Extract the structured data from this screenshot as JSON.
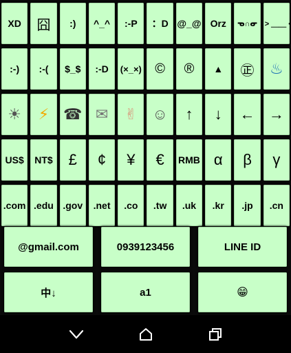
{
  "rows": [
    [
      "XD",
      "囧",
      ":)",
      "^_^",
      ":-P",
      "：D",
      "@_@",
      "Orz",
      "ᓀ∩ᓂ",
      "> ＿＿ <"
    ],
    [
      ":-)",
      ":-(",
      "$_$",
      ":-D",
      "(×_×)",
      "©",
      "®",
      "▲",
      "㊣",
      "♨"
    ],
    [
      "☀",
      "⚡",
      "☎",
      "✉",
      "✌",
      "☺",
      "↑",
      "↓",
      "←",
      "→"
    ],
    [
      "US$",
      "NT$",
      "£",
      "¢",
      "¥",
      "€",
      "RMB",
      "α",
      "β",
      "γ"
    ],
    [
      ".com",
      ".edu",
      ".gov",
      ".net",
      ".co",
      ".tw",
      ".uk",
      ".kr",
      ".jp",
      ".cn"
    ]
  ],
  "wide_rows": [
    [
      "@gmail.com",
      "0939123456",
      "LINE ID"
    ],
    [
      "中↓",
      "a1",
      "😁"
    ]
  ],
  "icons": {
    "row2": [
      "sun-icon",
      "lightning-icon",
      "telephone-icon",
      "envelope-icon",
      "victory-hand-icon",
      "smiley-icon",
      "arrow-up-icon",
      "arrow-down-icon",
      "arrow-left-icon",
      "arrow-right-icon"
    ],
    "nav": [
      "back-icon",
      "home-icon",
      "recents-icon"
    ]
  },
  "colors": {
    "key_bg": "#c8ffc8",
    "background": "#0a0a0a",
    "nav_bg": "#000000",
    "nav_icon": "#ffffff"
  }
}
